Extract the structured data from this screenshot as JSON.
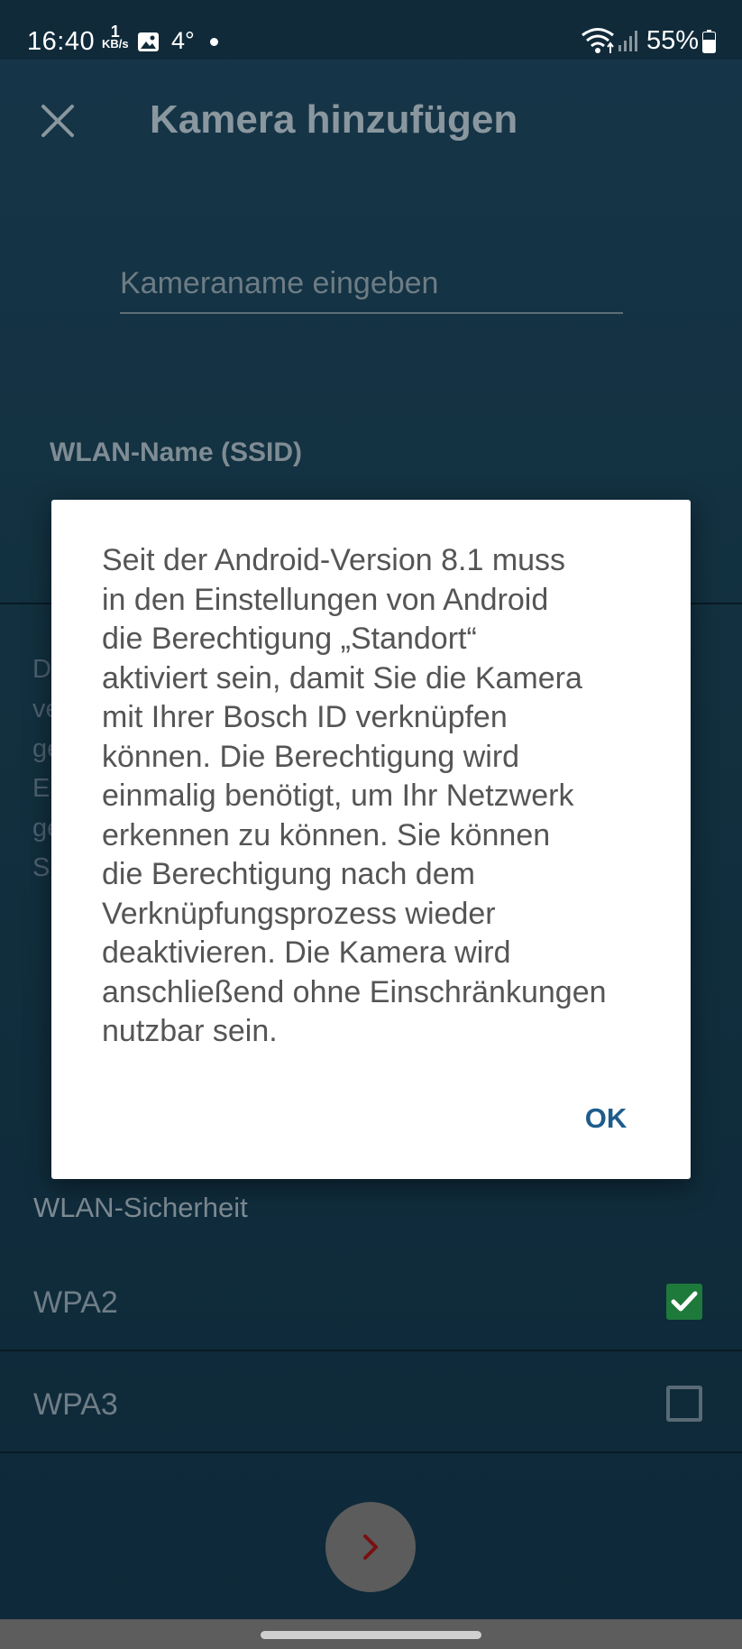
{
  "status_bar": {
    "time": "16:40",
    "net_speed_value": "1",
    "net_speed_unit": "KB/s",
    "temperature": "4°",
    "battery_percent": "55%"
  },
  "header": {
    "title": "Kamera hinzufügen"
  },
  "form": {
    "camera_name_placeholder": "Kameraname eingeben",
    "ssid_label": "WLAN-Name (SSID)",
    "info_partial_lines": [
      "D",
      "ve",
      "ge",
      "E",
      "ge",
      "S"
    ],
    "security_label": "WLAN-Sicherheit",
    "security_options": [
      {
        "label": "WPA2",
        "checked": true
      },
      {
        "label": "WPA3",
        "checked": false
      }
    ]
  },
  "dialog": {
    "message_lines": [
      "Seit der Android-Version 8.1 muss",
      "in den Einstellungen von Android",
      "die Berechtigung „Standort“",
      "aktiviert sein, damit Sie die Kamera",
      "mit Ihrer Bosch ID verknüpfen",
      "können. Die Berechtigung wird",
      "einmalig benötigt, um Ihr Netzwerk",
      "erkennen zu können. Sie können",
      "die Berechtigung nach dem",
      "Verknüpfungsprozess wieder",
      "deaktivieren. Die Kamera wird",
      "anschließend ohne Einschränkungen",
      "nutzbar sein."
    ],
    "ok_label": "OK"
  },
  "colors": {
    "background": "#12303f",
    "dialog_bg": "#ffffff",
    "ok_text": "#1e5c8c",
    "checkbox_checked": "#1e7a3a",
    "next_button": "#5c5c5c",
    "next_chevron": "#7a1010"
  },
  "icons": {
    "close": "close-icon",
    "gallery": "image-icon",
    "wifi": "wifi-icon",
    "signal": "signal-icon",
    "battery": "battery-icon",
    "check": "check-icon",
    "next": "chevron-right-icon"
  }
}
